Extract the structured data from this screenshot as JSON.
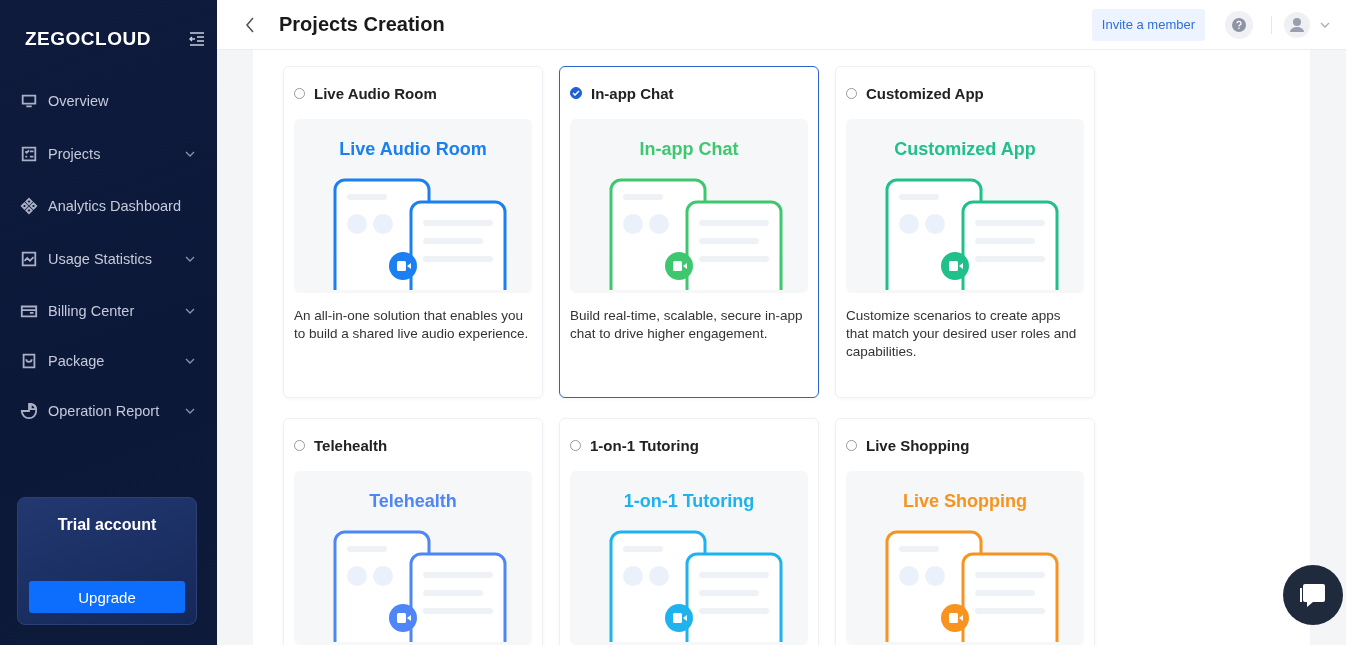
{
  "sidebar": {
    "logo": "ZEGOCLOUD",
    "items": [
      {
        "label": "Overview",
        "expandable": false
      },
      {
        "label": "Projects",
        "expandable": true
      },
      {
        "label": "Analytics Dashboard",
        "expandable": false
      },
      {
        "label": "Usage Statistics",
        "expandable": true
      },
      {
        "label": "Billing Center",
        "expandable": true
      },
      {
        "label": "Package",
        "expandable": true
      },
      {
        "label": "Operation Report",
        "expandable": true
      }
    ],
    "trial": {
      "title": "Trial account",
      "button": "Upgrade"
    }
  },
  "header": {
    "title": "Projects Creation",
    "invite_button": "Invite a member"
  },
  "cards": [
    {
      "title": "Live Audio Room",
      "selected": false,
      "banner_title": "Live Audio Room",
      "color": "#1a7ff0",
      "description": "An all-in-one solution that enables you to build a shared live audio experience."
    },
    {
      "title": "In-app Chat",
      "selected": true,
      "banner_title": "In-app Chat",
      "color": "#3dc86f",
      "description": "Build real-time, scalable, secure in-app chat to drive higher engagement."
    },
    {
      "title": "Customized App",
      "selected": false,
      "banner_title": "Customized App",
      "color": "#21c08a",
      "description": "Customize scenarios to create apps that match your desired user roles and capabilities."
    },
    {
      "title": "Telehealth",
      "selected": false,
      "banner_title": "Telehealth",
      "color": "#4f86f7"
    },
    {
      "title": "1-on-1 Tutoring",
      "selected": false,
      "banner_title": "1-on-1 Tutoring",
      "color": "#1eb3ef"
    },
    {
      "title": "Live Shopping",
      "selected": false,
      "banner_title": "Live Shopping",
      "color": "#f7931e"
    }
  ]
}
